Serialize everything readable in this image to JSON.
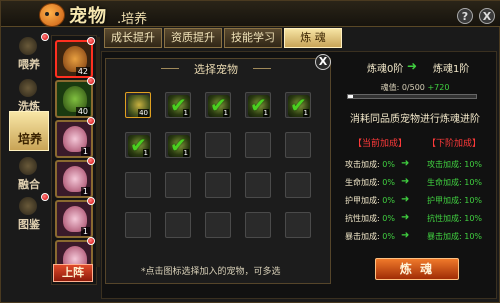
{
  "window": {
    "title_main": "宠物",
    "title_sub": ".培养",
    "help_label": "?",
    "close_label": "X"
  },
  "sidenav": [
    {
      "label": "喂养",
      "badge": true
    },
    {
      "label": "洗炼",
      "badge": false
    },
    {
      "label": "培养",
      "badge": false,
      "active": true
    },
    {
      "label": "融合",
      "badge": false
    },
    {
      "label": "图鉴",
      "badge": true
    }
  ],
  "pets": [
    {
      "level": "42",
      "color": "#c87a30",
      "badge": true
    },
    {
      "level": "40",
      "color": "#4a8a30",
      "badge": true
    },
    {
      "level": "1",
      "color": "#e8a0c0",
      "badge": true
    },
    {
      "level": "1",
      "color": "#e8a0c0",
      "badge": true
    },
    {
      "level": "1",
      "color": "#e8a0c0",
      "badge": true
    },
    {
      "level": "1",
      "color": "#e8a0c0",
      "badge": true
    }
  ],
  "deploy_button": "上阵",
  "tabs": [
    "成长提升",
    "资质提升",
    "技能学习",
    "炼 魂"
  ],
  "active_tab": 3,
  "select_panel": {
    "title": "选择宠物",
    "close_label": "X",
    "hint": "*点击图标选择加入的宠物，可多选",
    "slots": [
      {
        "pet": true,
        "num": "40",
        "checked": false,
        "highlight": true
      },
      {
        "pet": true,
        "num": "1",
        "checked": true
      },
      {
        "pet": true,
        "num": "1",
        "checked": true
      },
      {
        "pet": true,
        "num": "1",
        "checked": true
      },
      {
        "pet": true,
        "num": "1",
        "checked": true
      },
      {
        "pet": true,
        "num": "1",
        "checked": true
      },
      {
        "pet": true,
        "num": "1",
        "checked": true
      }
    ]
  },
  "info": {
    "from_level": "炼魂0阶",
    "to_level": "炼魂1阶",
    "arrow": "➜",
    "soul_label": "魂值:",
    "soul_current": "0/500",
    "soul_plus": "+720",
    "soul_progress": 0.04,
    "desc": "消耗同品质宠物进行炼魂进阶",
    "cur_header": "【当前加成】",
    "next_header": "【下阶加成】",
    "stats": [
      {
        "name": "攻击加成:",
        "cur": "0%",
        "next": "10%"
      },
      {
        "name": "生命加成:",
        "cur": "0%",
        "next": "10%"
      },
      {
        "name": "护甲加成:",
        "cur": "0%",
        "next": "10%"
      },
      {
        "name": "抗性加成:",
        "cur": "0%",
        "next": "10%"
      },
      {
        "name": "暴击加成:",
        "cur": "0%",
        "next": "10%"
      }
    ],
    "next_names": [
      "攻击加成:",
      "生命加成:",
      "护甲加成:",
      "抗性加成:",
      "暴击加成:"
    ]
  },
  "lianhun_button": "炼 魂"
}
